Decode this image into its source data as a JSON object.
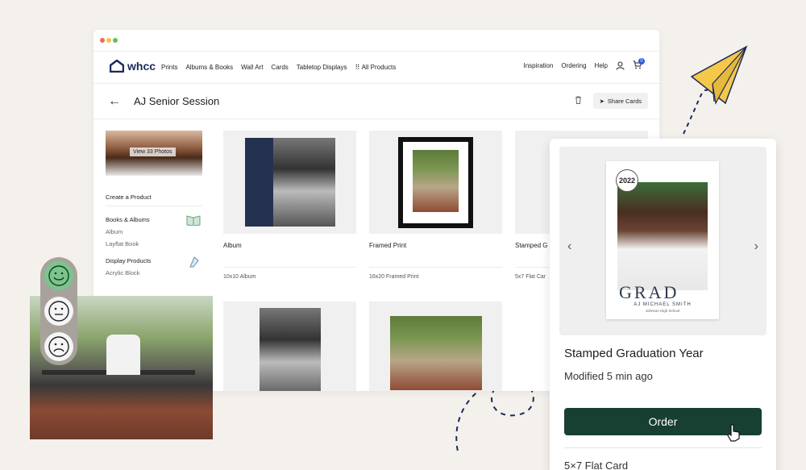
{
  "window": {
    "controls": [
      "close",
      "minimize",
      "maximize"
    ]
  },
  "nav": {
    "brand": "whcc",
    "links": [
      "Prints",
      "Albums & Books",
      "Wall Art",
      "Cards",
      "Tabletop Displays",
      "All Products"
    ],
    "right_links": [
      "Inspiration",
      "Ordering",
      "Help"
    ],
    "cart_count": "0"
  },
  "header": {
    "title": "AJ Senior Session",
    "share_label": "Share Cards"
  },
  "sidebar": {
    "view_photos": "View 33 Photos",
    "create_label": "Create a Product",
    "categories": [
      {
        "title": "Books & Albums",
        "items": [
          "Album",
          "Layflat Book"
        ]
      },
      {
        "title": "Display Products",
        "items": [
          "Acrylic Block"
        ]
      }
    ]
  },
  "products": [
    {
      "name": "Album",
      "size": "10x10 Album"
    },
    {
      "name": "Framed Print",
      "size": "16x20 Framed Print"
    },
    {
      "name": "Stamped G",
      "size": "5x7 Flat Car"
    }
  ],
  "detail": {
    "card": {
      "year": "2022",
      "grad_text": "GRAD",
      "name": "AJ MICHAEL SMITH",
      "school": "Johnson High School"
    },
    "title": "Stamped Graduation Year",
    "modified": "Modified 5 min ago",
    "order_label": "Order",
    "size": "5×7 Flat Card"
  },
  "feedback": {
    "options": [
      "happy",
      "neutral",
      "sad"
    ],
    "selected": "happy"
  },
  "colors": {
    "brand": "#1a2a5c",
    "order_button": "#173f32",
    "accent_yellow": "#f5c84a",
    "happy": "#7ac58c"
  }
}
